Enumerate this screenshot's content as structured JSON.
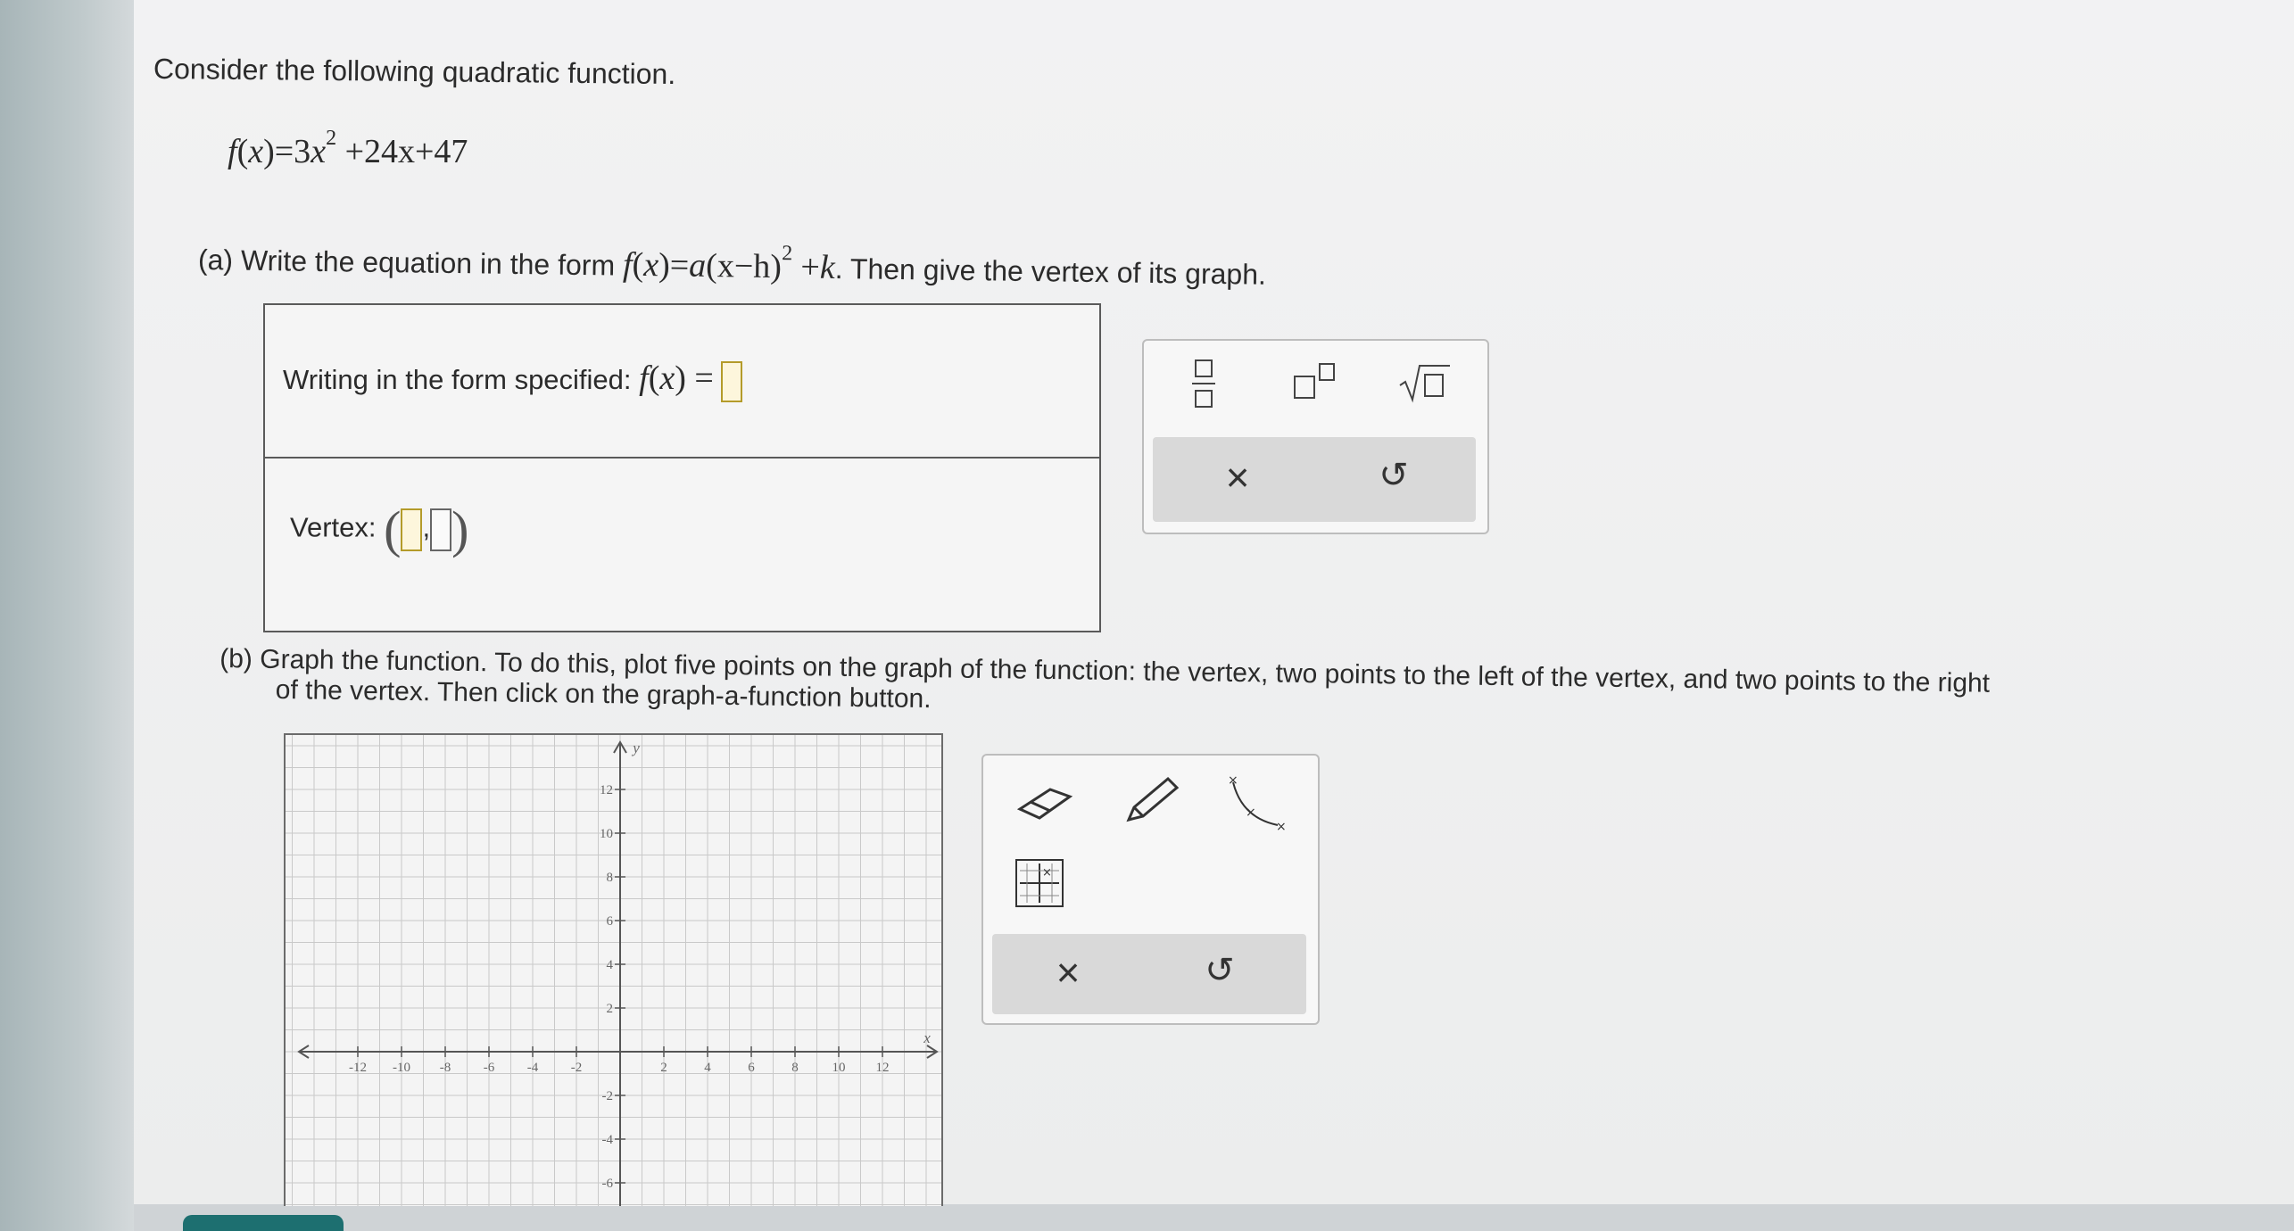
{
  "problem": {
    "intro": "Consider the following quadratic function.",
    "function": {
      "lhs": "f",
      "arg": "x",
      "rhs_prefix": "=3",
      "var": "x",
      "exp": "2",
      "rhs_suffix": "+24x+47"
    }
  },
  "part_a": {
    "label": "(a)",
    "prompt_start": "Write the equation in the form",
    "form_f": "f",
    "form_x": "x",
    "form_eq": "=",
    "form_a": "a",
    "form_paren": "(x−h)",
    "form_exp": "2",
    "form_plus": "+",
    "form_k": "k",
    "prompt_end": ". Then give the vertex of its graph.",
    "writing_label": "Writing in the form specified:",
    "writing_f": "f",
    "writing_x": "x",
    "writing_eq": "=",
    "vertex_label": "Vertex:",
    "vertex_comma": ","
  },
  "part_b": {
    "label": "(b)",
    "line1": "Graph the function. To do this, plot five points on the graph of the function: the vertex, two points to the left of the vertex, and two points to the right",
    "line2": "of the vertex. Then click on the graph-a-function button."
  },
  "graph": {
    "y_axis_label": "y",
    "x_axis_label": "x",
    "x_ticks": [
      "-12",
      "-10",
      "-8",
      "-6",
      "-4",
      "-2",
      "2",
      "4",
      "6",
      "8",
      "10",
      "12"
    ],
    "y_ticks": [
      "12",
      "10",
      "8",
      "6",
      "4",
      "2",
      "-2",
      "-4",
      "-6"
    ]
  },
  "math_toolbox": {
    "icons": [
      "fraction-icon",
      "superscript-icon",
      "square-root-icon",
      "clear-icon",
      "undo-icon"
    ],
    "clear_glyph": "×",
    "undo_glyph": "↺"
  },
  "graph_toolbox": {
    "icons": [
      "eraser-icon",
      "pencil-icon",
      "graph-a-function-icon",
      "grid-points-icon",
      "clear-icon",
      "undo-icon"
    ],
    "clear_glyph": "×",
    "undo_glyph": "↺"
  },
  "colors": {
    "answer_slot": "#b49b2a",
    "bottom_tab": "#1d6f70"
  }
}
